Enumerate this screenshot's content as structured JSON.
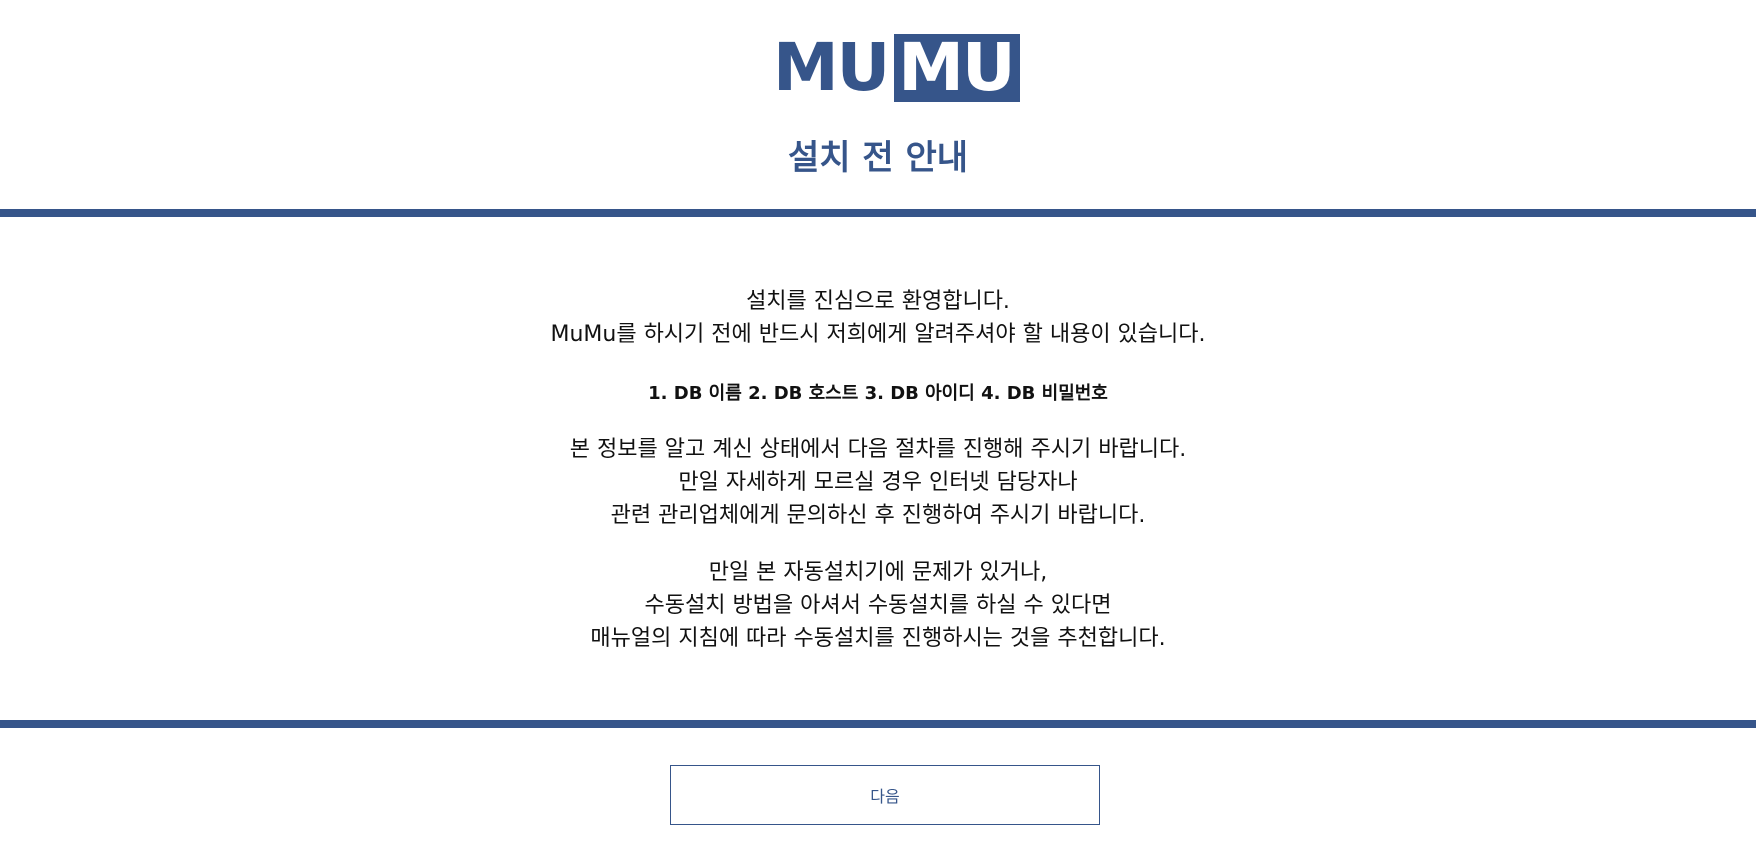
{
  "brand": {
    "logo_left": "MU",
    "logo_right": "MU",
    "accent": "#36558a"
  },
  "header": {
    "title": "설치 전 안내"
  },
  "intro": {
    "lines": [
      "설치를 진심으로 환영합니다.",
      "MuMu를 하시기 전에 반드시 저희에게 알려주셔야 할 내용이 있습니다."
    ]
  },
  "requirements": {
    "text": "1. DB 이름 2. DB 호스트 3. DB 아이디 4. DB 비밀번호"
  },
  "guidance": {
    "lines": [
      "본 정보를 알고 계신 상태에서 다음 절차를 진행해 주시기 바랍니다.",
      "만일 자세하게 모르실 경우 인터넷 담당자나",
      "관련 관리업체에게 문의하신 후 진행하여 주시기 바랍니다."
    ]
  },
  "manual": {
    "lines": [
      "만일 본 자동설치기에 문제가 있거나,",
      "수동설치 방법을 아셔서 수동설치를 하실 수 있다면",
      "매뉴얼의 지침에 따라 수동설치를 진행하시는 것을 추천합니다."
    ]
  },
  "footer": {
    "next_label": "다음"
  }
}
